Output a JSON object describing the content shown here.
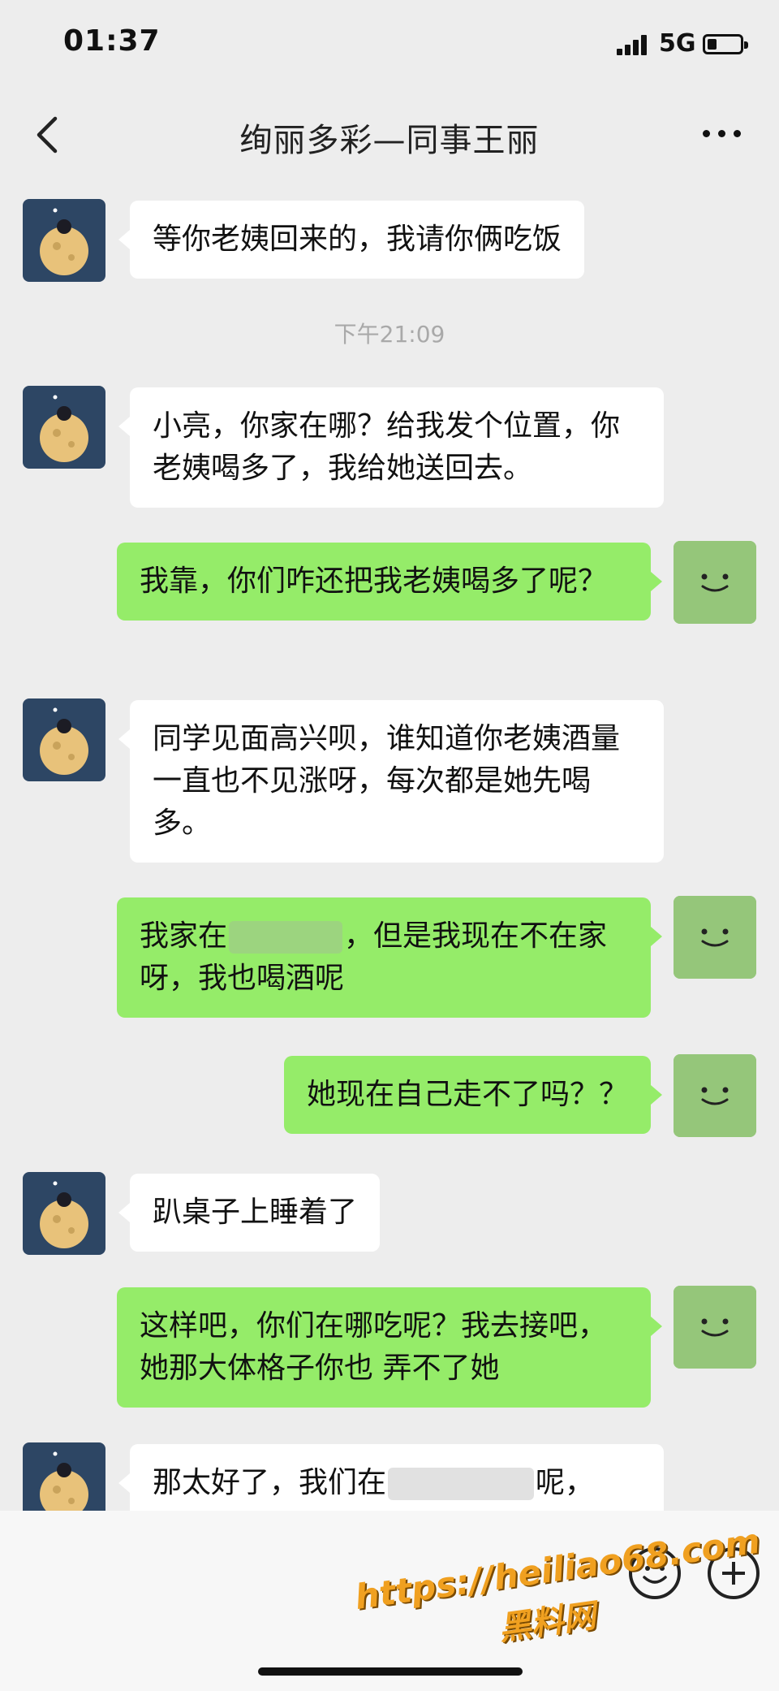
{
  "status": {
    "time": "01:37",
    "network": "5G"
  },
  "nav": {
    "title": "绚丽多彩—同事王丽"
  },
  "time_separator": "下午21:09",
  "messages": [
    {
      "text": "等你老姨回来的，我请你俩吃饭"
    },
    {
      "text": "小亮，你家在哪？给我发个位置，你老姨喝多了，我给她送回去。"
    },
    {
      "text": "我靠，你们咋还把我老姨喝多了呢？"
    },
    {
      "text": "同学见面高兴呗，谁知道你老姨酒量一直也不见涨呀，每次都是她先喝多。"
    },
    {
      "text_before": "我家在",
      "text_after": "，但是我现在不在家呀，我也喝酒呢"
    },
    {
      "text": "她现在自己走不了吗？？"
    },
    {
      "text": "趴桌子上睡着了"
    },
    {
      "text": "这样吧，你们在哪吃呢？我去接吧，她那大体格子你也 弄不了她"
    },
    {
      "text_before": "那太好了，我们在",
      "text_after": "呢，"
    }
  ],
  "watermark": {
    "line1": "https://heiliao68.com",
    "line2": "黑料网"
  },
  "colors": {
    "background": "#ededed",
    "incoming_bubble": "#ffffff",
    "outgoing_bubble": "#95ec69",
    "timestamp": "#a9a9a9"
  }
}
